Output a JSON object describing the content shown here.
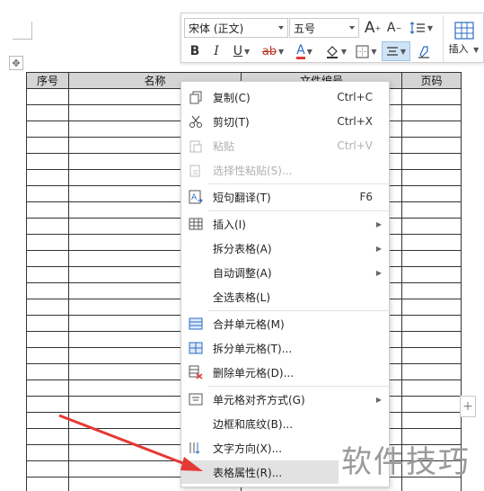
{
  "toolbar": {
    "font_name": "宋体 (正文)",
    "font_size": "五号",
    "grow_font": "A",
    "shrink_font": "A",
    "bold": "B",
    "italic": "I",
    "underline": "U",
    "strike": "ab",
    "font_color": "A",
    "insert_label": "插入"
  },
  "table": {
    "headers": [
      "序号",
      "名称",
      "文件编号",
      "页码"
    ],
    "row_count": 25
  },
  "menu": {
    "items": [
      {
        "label": "复制(C)",
        "shortcut": "Ctrl+C",
        "icon": "copy-icon"
      },
      {
        "label": "剪切(T)",
        "shortcut": "Ctrl+X",
        "icon": "scissors-icon"
      },
      {
        "label": "粘贴",
        "shortcut": "Ctrl+V",
        "icon": "paste-icon"
      },
      {
        "label": "选择性粘贴(S)...",
        "icon": "paste-special-icon"
      },
      {
        "label": "短句翻译(T)",
        "shortcut": "F6",
        "icon": "translate-icon"
      },
      {
        "label": "插入(I)",
        "icon": "table-insert-icon"
      },
      {
        "label": "拆分表格(A)"
      },
      {
        "label": "自动调整(A)"
      },
      {
        "label": "全选表格(L)"
      },
      {
        "label": "合并单元格(M)",
        "icon": "merge-cells-icon"
      },
      {
        "label": "拆分单元格(T)...",
        "icon": "split-cells-icon"
      },
      {
        "label": "删除单元格(D)...",
        "icon": "delete-cells-icon"
      },
      {
        "label": "单元格对齐方式(G)",
        "icon": "align-icon"
      },
      {
        "label": "边框和底纹(B)..."
      },
      {
        "label": "文字方向(X)...",
        "icon": "text-direction-icon"
      },
      {
        "label": "表格属性(R)..."
      }
    ]
  },
  "watermark": "软件技巧",
  "colors": {
    "arrow": "#e53935",
    "menu_hover": "#e2e2e2",
    "header_bg": "#d5d5d5",
    "accent_blue": "#2b6cc4"
  }
}
